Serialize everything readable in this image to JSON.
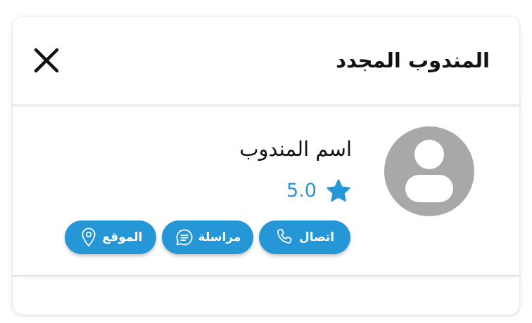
{
  "header": {
    "title": "المندوب المجدد",
    "close_icon": "close-icon"
  },
  "agent": {
    "name": "اسم المندوب",
    "rating": "5.0",
    "avatar_icon": "user-placeholder-icon"
  },
  "actions": [
    {
      "label": "اتصال",
      "icon": "phone-icon"
    },
    {
      "label": "مراسلة",
      "icon": "chat-icon"
    },
    {
      "label": "الموقع",
      "icon": "location-pin-icon"
    }
  ],
  "colors": {
    "accent": "#2596d6",
    "avatar_bg": "#a9a8a8",
    "text": "#111111"
  }
}
